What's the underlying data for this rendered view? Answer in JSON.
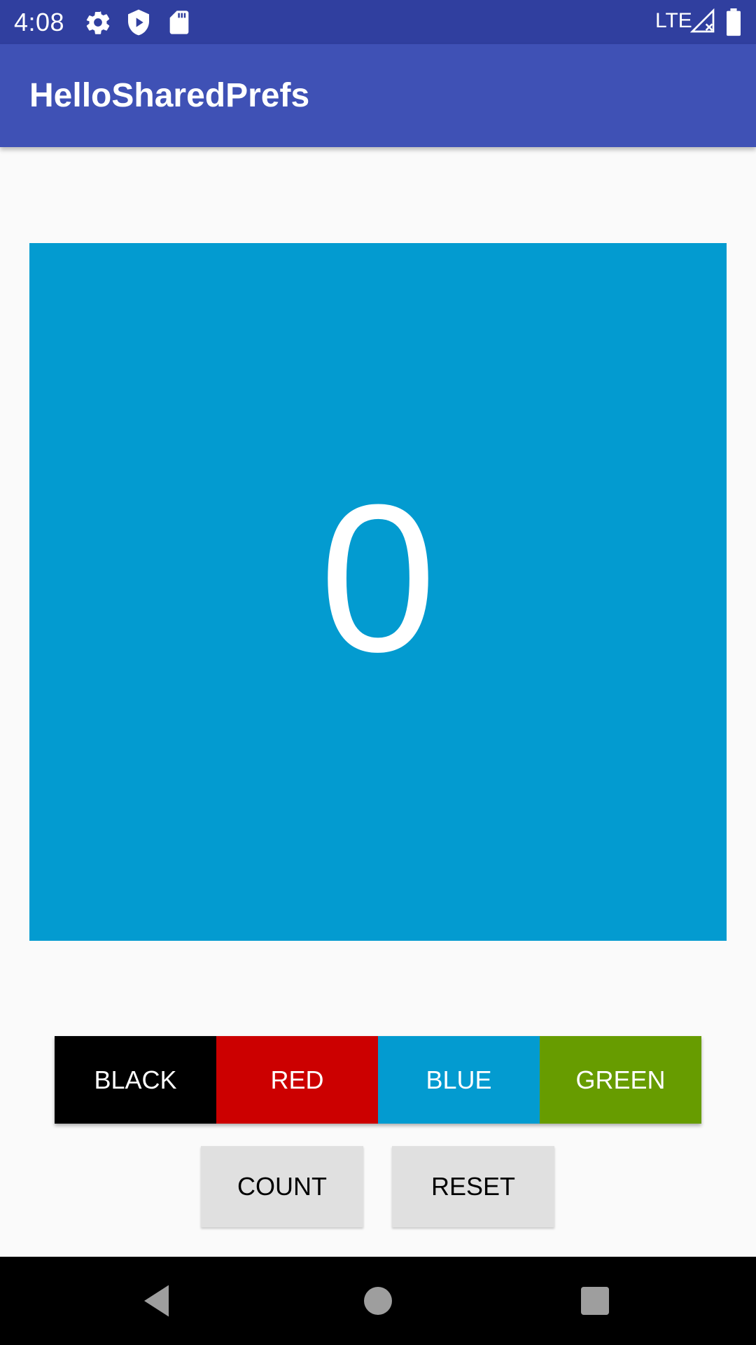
{
  "status_bar": {
    "time": "4:08",
    "network": "LTE",
    "icons": [
      "settings-gear-icon",
      "play-protect-shield-icon",
      "sd-card-icon",
      "signal-no-service-icon",
      "battery-full-icon"
    ],
    "background_color": "#303f9f"
  },
  "app_bar": {
    "title": "HelloSharedPrefs",
    "background_color": "#3f51b5"
  },
  "counter": {
    "value": "0",
    "background_color": "#039bd0"
  },
  "color_buttons": [
    {
      "label": "BLACK",
      "color": "#000000"
    },
    {
      "label": "RED",
      "color": "#cc0000"
    },
    {
      "label": "BLUE",
      "color": "#039bd0"
    },
    {
      "label": "GREEN",
      "color": "#679c00"
    }
  ],
  "actions": {
    "count_label": "COUNT",
    "reset_label": "RESET"
  },
  "nav_bar": {
    "icons": [
      "back-icon",
      "home-icon",
      "recents-icon"
    ]
  }
}
